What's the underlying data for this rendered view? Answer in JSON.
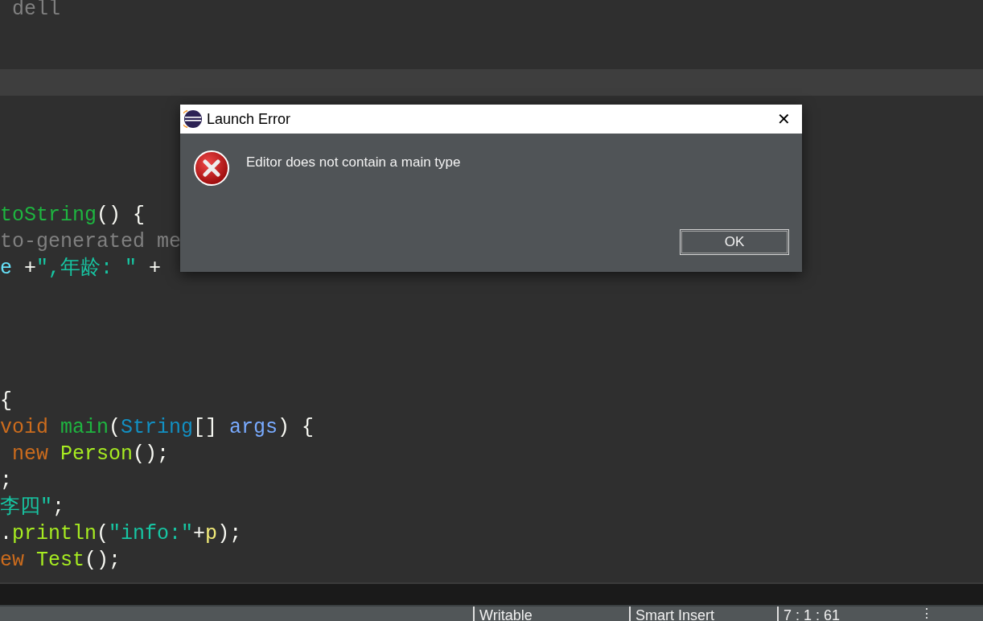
{
  "editor": {
    "lines": [
      {
        "kind": "code",
        "tokens": [
          {
            "text": " dell",
            "kind": "comment"
          }
        ]
      },
      {
        "kind": "blank"
      },
      {
        "kind": "blank"
      },
      {
        "kind": "blank",
        "current": true
      },
      {
        "kind": "blank"
      },
      {
        "kind": "blank"
      },
      {
        "kind": "blank"
      },
      {
        "kind": "blank"
      },
      {
        "kind": "code",
        "tokens": [
          {
            "text": "toString",
            "kind": "method"
          },
          {
            "text": "() {",
            "kind": "plain"
          }
        ]
      },
      {
        "kind": "code",
        "tokens": [
          {
            "text": "to-generated me",
            "kind": "comment"
          }
        ]
      },
      {
        "kind": "code",
        "tokens": [
          {
            "text": "e",
            "kind": "field"
          },
          {
            "text": " +",
            "kind": "plain"
          },
          {
            "text": "\",年龄: \"",
            "kind": "string"
          },
          {
            "text": " + ",
            "kind": "plain"
          }
        ]
      },
      {
        "kind": "blank"
      },
      {
        "kind": "blank"
      },
      {
        "kind": "blank"
      },
      {
        "kind": "blank"
      },
      {
        "kind": "code",
        "tokens": [
          {
            "text": "{",
            "kind": "plain"
          }
        ]
      },
      {
        "kind": "code",
        "tokens": [
          {
            "text": "void",
            "kind": "keyword"
          },
          {
            "text": " main",
            "kind": "method"
          },
          {
            "text": "(",
            "kind": "plain"
          },
          {
            "text": "String",
            "kind": "type"
          },
          {
            "text": "[] ",
            "kind": "plain"
          },
          {
            "text": "args",
            "kind": "param"
          },
          {
            "text": ") {",
            "kind": "plain"
          }
        ]
      },
      {
        "kind": "code",
        "tokens": [
          {
            "text": " new",
            "kind": "keyword"
          },
          {
            "text": " Person",
            "kind": "class"
          },
          {
            "text": "();",
            "kind": "plain"
          }
        ]
      },
      {
        "kind": "code",
        "tokens": [
          {
            "text": ";",
            "kind": "plain"
          }
        ]
      },
      {
        "kind": "code",
        "tokens": [
          {
            "text": "李四\"",
            "kind": "string"
          },
          {
            "text": ";",
            "kind": "plain"
          }
        ]
      },
      {
        "kind": "code",
        "tokens": [
          {
            "text": ".",
            "kind": "plain"
          },
          {
            "text": "println",
            "kind": "class"
          },
          {
            "text": "(",
            "kind": "plain"
          },
          {
            "text": "\"info:\"",
            "kind": "string"
          },
          {
            "text": "+",
            "kind": "plain"
          },
          {
            "text": "p",
            "kind": "local"
          },
          {
            "text": ");",
            "kind": "plain"
          }
        ]
      },
      {
        "kind": "code",
        "tokens": [
          {
            "text": "ew",
            "kind": "keyword"
          },
          {
            "text": " Test",
            "kind": "class"
          },
          {
            "text": "();",
            "kind": "plain"
          }
        ]
      }
    ]
  },
  "dialog": {
    "title": "Launch Error",
    "close": "✕",
    "message": "Editor does not contain a main type",
    "buttons": [
      "OK"
    ]
  },
  "status_bar": {
    "fields": [
      "Writable",
      "Smart Insert",
      "7 : 1 : 61"
    ],
    "menu": "⋮"
  }
}
